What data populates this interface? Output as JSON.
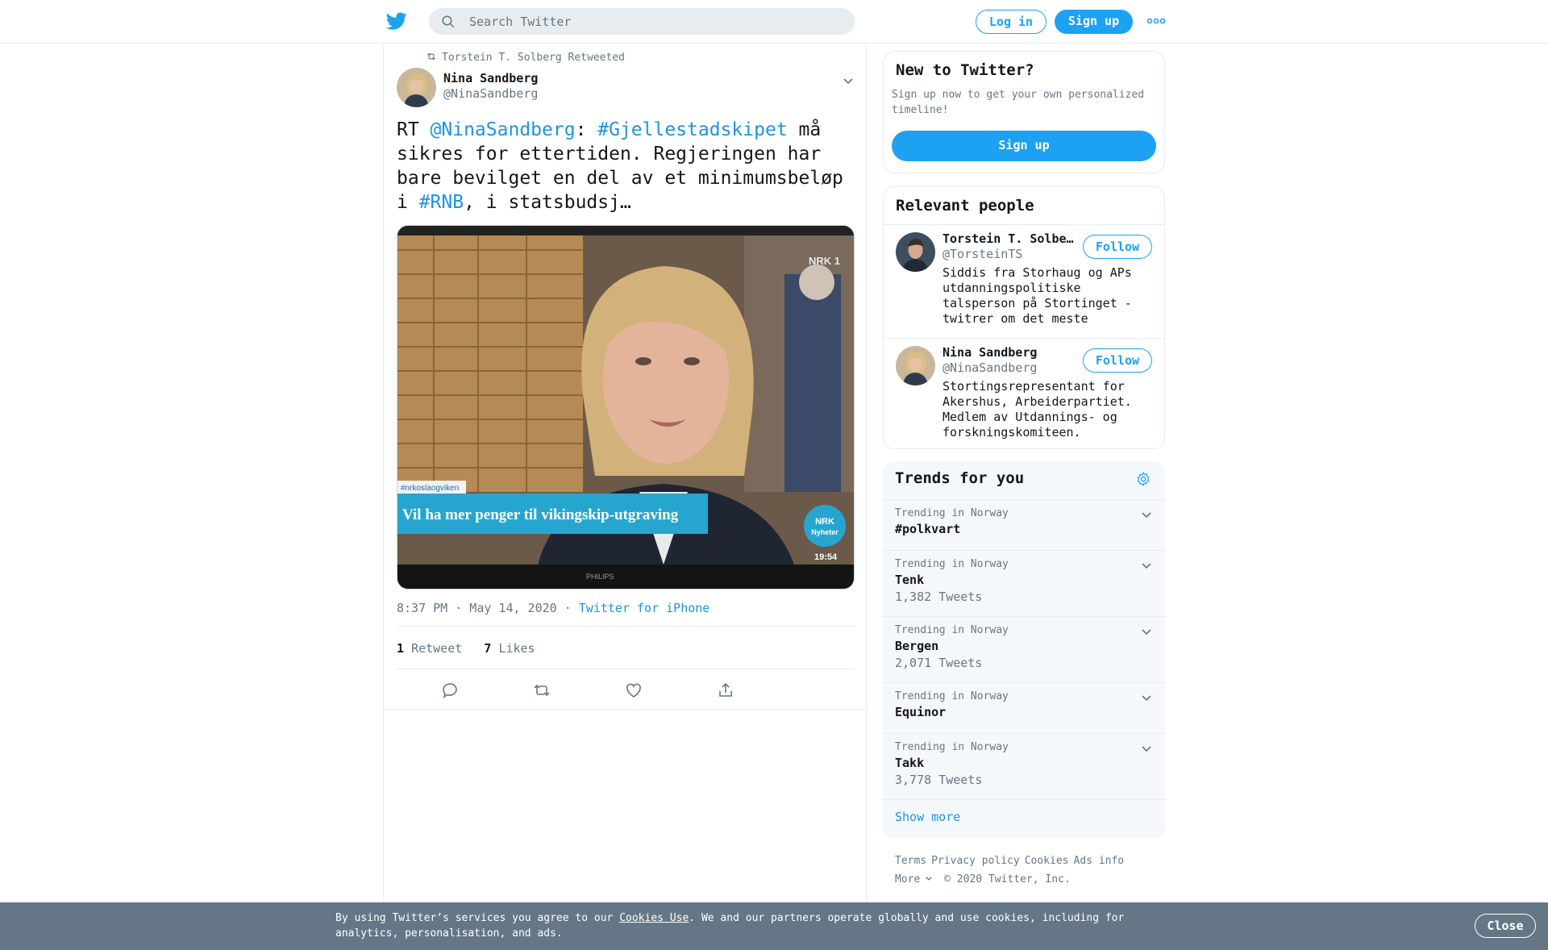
{
  "header": {
    "search_placeholder": "Search Twitter",
    "login_label": "Log in",
    "signup_label": "Sign up",
    "more_icon": "more-dots-icon",
    "accent_color": "#1da1f2"
  },
  "tweet": {
    "retweet_context": "Torstein T. Solberg Retweeted",
    "author_name": "Nina Sandberg",
    "author_handle": "@NinaSandberg",
    "text_parts": {
      "p1": "RT ",
      "mention": "@NinaSandberg",
      "p2": ": ",
      "hashtag1": "#Gjellestadskipet",
      "p3": " må sikres for ettertiden. Regjeringen har bare bevilget en del av et minimumsbeløp i ",
      "hashtag2": "#RNB",
      "p4": ", i statsbudsj…"
    },
    "media": {
      "tv_channel": "NRK 1",
      "hashtag_overlay": "#nrkoslaogviken",
      "headline_overlay": "Vil ha mer penger til vikingskip-utgraving",
      "badge_line1": "NRK",
      "badge_line2": "Nyheter",
      "clock": "19:54",
      "tv_brand": "PHILIPS"
    },
    "time": "8:37 PM · May 14, 2020",
    "dot": "·",
    "source": "Twitter for iPhone",
    "retweet_count": "1",
    "retweet_label": "Retweet",
    "like_count": "7",
    "like_label": "Likes"
  },
  "sidebar": {
    "new_to_twitter": {
      "title": "New to Twitter?",
      "description": "Sign up now to get your own personalized timeline!",
      "button": "Sign up"
    },
    "relevant_people": {
      "title": "Relevant people",
      "people": [
        {
          "name": "Torstein T. Solberg",
          "handle": "@TorsteinTS",
          "bio": "Siddis fra Storhaug og APs utdanningspolitiske talsperson på Stortinget - twitrer om det meste",
          "follow": "Follow"
        },
        {
          "name": "Nina Sandberg",
          "handle": "@NinaSandberg",
          "bio": "Stortingsrepresentant for Akershus, Arbeiderpartiet. Medlem av Utdannings- og forskningskomiteen.",
          "follow": "Follow"
        }
      ]
    },
    "trends": {
      "title": "Trends for you",
      "items": [
        {
          "context": "Trending in Norway",
          "name": "#polkvart",
          "count": ""
        },
        {
          "context": "Trending in Norway",
          "name": "Tenk",
          "count": "1,382 Tweets"
        },
        {
          "context": "Trending in Norway",
          "name": "Bergen",
          "count": "2,071 Tweets"
        },
        {
          "context": "Trending in Norway",
          "name": "Equinor",
          "count": ""
        },
        {
          "context": "Trending in Norway",
          "name": "Takk",
          "count": "3,778 Tweets"
        }
      ],
      "show_more": "Show more"
    },
    "footer": {
      "terms": "Terms",
      "privacy": "Privacy policy",
      "cookies": "Cookies",
      "ads": "Ads info",
      "more": "More",
      "copyright": "© 2020 Twitter, Inc."
    }
  },
  "cookie_banner": {
    "text_before": "By using Twitter’s services you agree to our ",
    "link": "Cookies Use",
    "text_after": ". We and our partners operate globally and use cookies, including for analytics, personalisation, and ads.",
    "close": "Close"
  }
}
